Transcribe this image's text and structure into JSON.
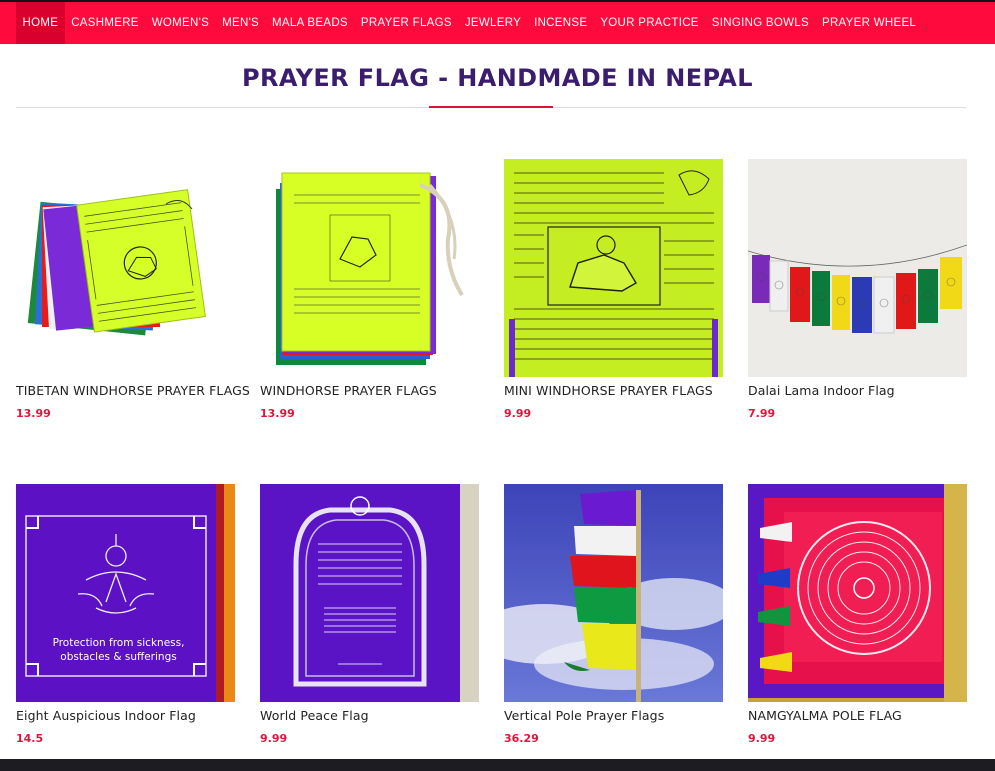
{
  "nav": {
    "items": [
      {
        "label": "HOME",
        "active": true
      },
      {
        "label": "CASHMERE"
      },
      {
        "label": "WOMEN'S"
      },
      {
        "label": "MEN'S"
      },
      {
        "label": "MALA BEADS"
      },
      {
        "label": "PRAYER FLAGS"
      },
      {
        "label": "JEWLERY"
      },
      {
        "label": "INCENSE"
      },
      {
        "label": "YOUR PRACTICE"
      },
      {
        "label": "SINGING BOWLS"
      },
      {
        "label": "PRAYER WHEEL"
      }
    ]
  },
  "page": {
    "title": "PRAYER FLAG - HANDMADE IN NEPAL"
  },
  "products": [
    {
      "name": "TIBETAN WINDHORSE PRAYER FLAGS",
      "price": "13.99",
      "image": "stacked-windhorse-flags"
    },
    {
      "name": "WINDHORSE PRAYER FLAGS",
      "price": "13.99",
      "image": "windhorse-flag-bundle"
    },
    {
      "name": "MINI WINDHORSE PRAYER FLAGS",
      "price": "9.99",
      "image": "mini-windhorse-flag-closeup"
    },
    {
      "name": "Dalai Lama Indoor Flag",
      "price": "7.99",
      "image": "hanging-flag-string"
    },
    {
      "name": "Eight Auspicious Indoor Flag",
      "price": "14.5",
      "image": "purple-auspicious-flag",
      "image_text": [
        "Protection from sickness,",
        "obstacles & sufferings"
      ]
    },
    {
      "name": "World Peace Flag",
      "price": "9.99",
      "image": "purple-world-peace-flag"
    },
    {
      "name": "Vertical Pole Prayer Flags",
      "price": "36.29",
      "image": "vertical-pole-flags"
    },
    {
      "name": "NAMGYALMA POLE FLAG",
      "price": "9.99",
      "image": "namgyalma-mandala-flag"
    }
  ],
  "colors": {
    "nav_bg": "#ff0a3c",
    "nav_active": "#d9002d",
    "title": "#3a1d6e",
    "accent": "#d4183c",
    "price": "#e0153b"
  }
}
